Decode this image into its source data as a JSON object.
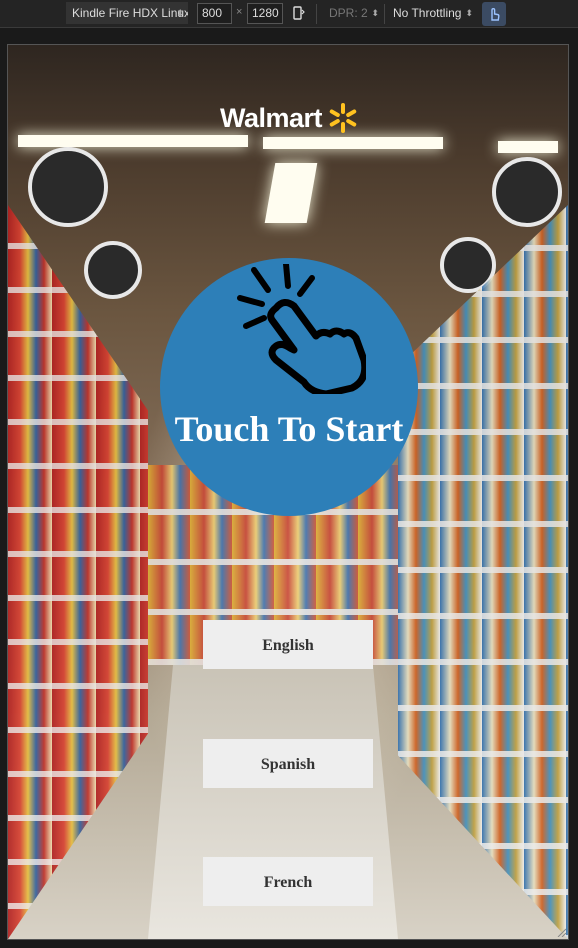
{
  "devtools": {
    "device": "Kindle Fire HDX  Linux",
    "width": "800",
    "height": "1280",
    "times": "×",
    "dpr": "DPR: 2",
    "throttling": "No Throttling",
    "caret": "⬍"
  },
  "brand": {
    "name": "Walmart",
    "spark_color": "#ffc220"
  },
  "touch": {
    "label": "Touch To Start",
    "circle_color": "#2d7fb8"
  },
  "languages": [
    {
      "label": "English"
    },
    {
      "label": "Spanish"
    },
    {
      "label": "French"
    }
  ]
}
